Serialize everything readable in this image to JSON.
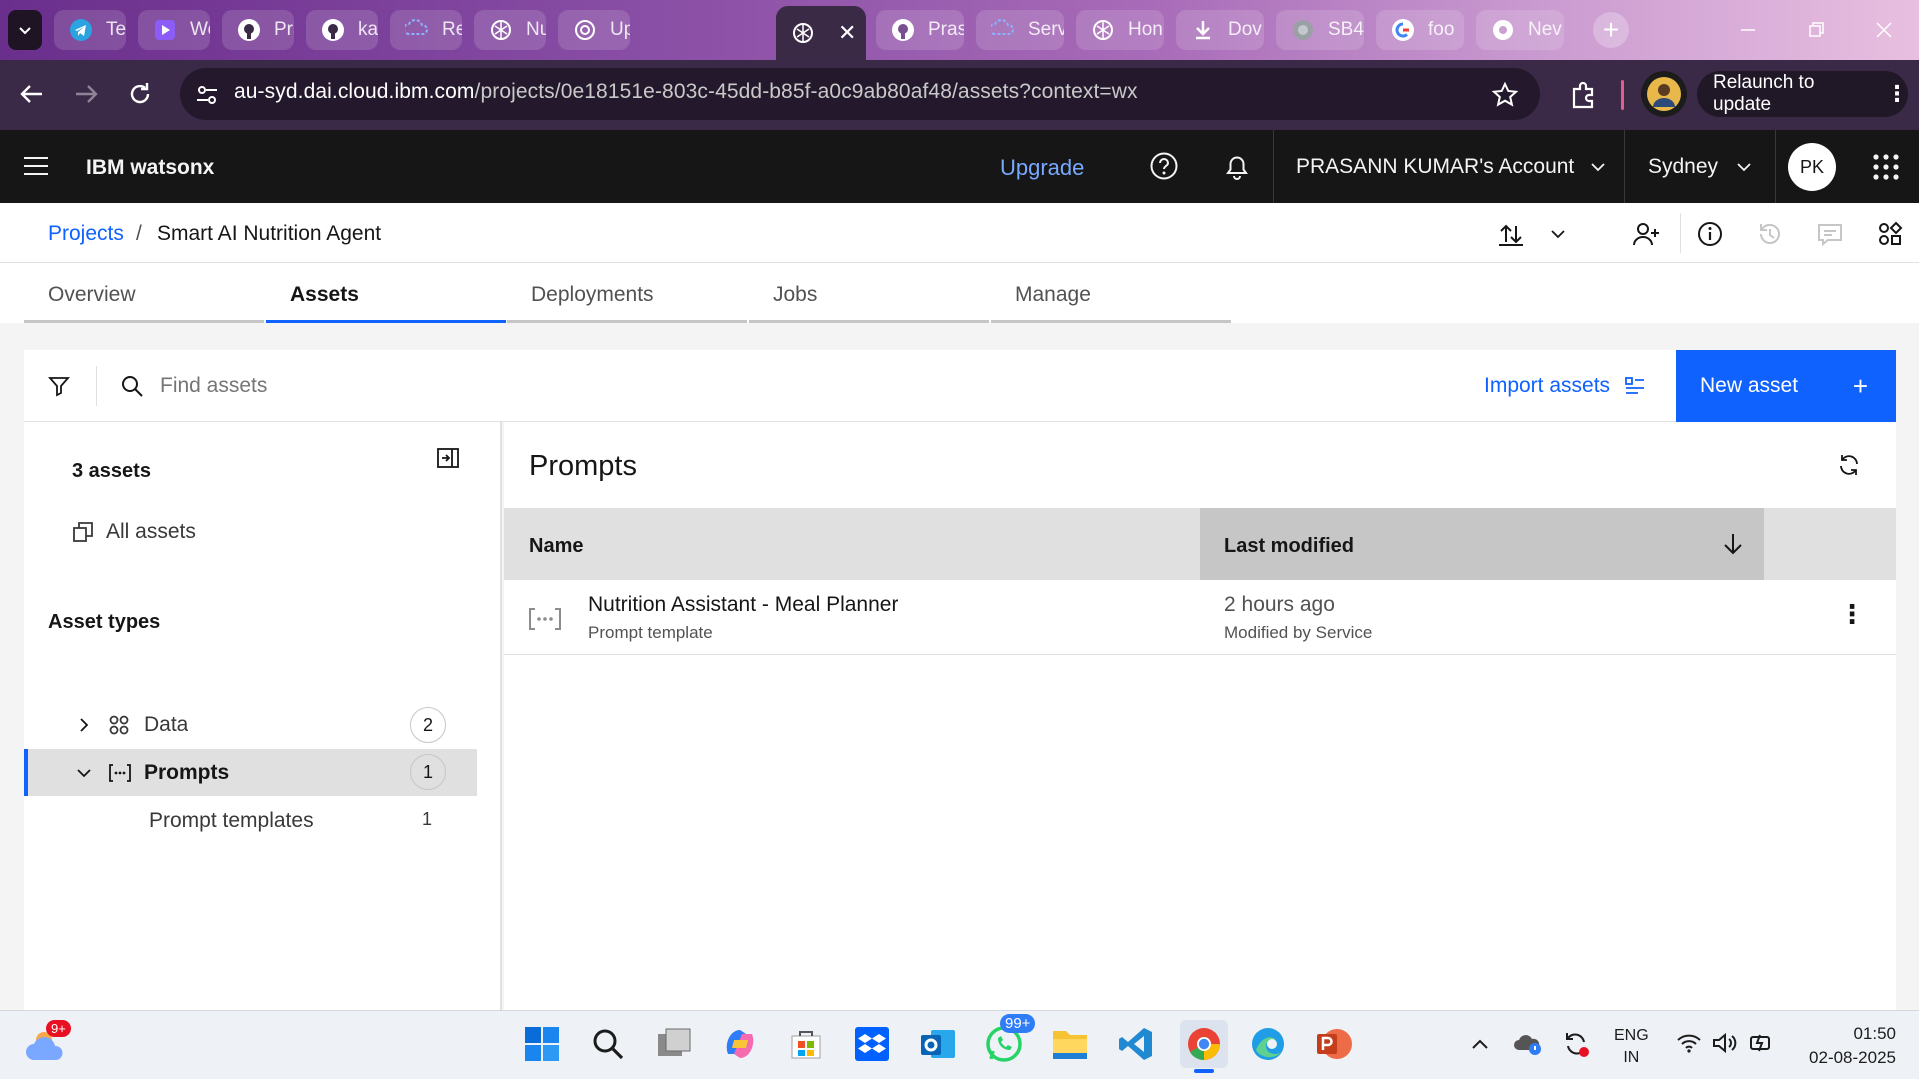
{
  "browser": {
    "tabs": [
      {
        "label": "Tele",
        "icon": "telegram-icon"
      },
      {
        "label": "Wee",
        "icon": "video-icon"
      },
      {
        "label": "Pras",
        "icon": "github-icon"
      },
      {
        "label": "kail",
        "icon": "github-icon"
      },
      {
        "label": "Reso",
        "icon": "ibm-cloud-icon"
      },
      {
        "label": "Nut",
        "icon": "watsonx-icon"
      },
      {
        "label": "Upl",
        "icon": "openai-icon"
      },
      {
        "label": "",
        "icon": "watsonx-icon",
        "active": true
      },
      {
        "label": "Pras",
        "icon": "github-icon"
      },
      {
        "label": "Serv",
        "icon": "ibm-cloud-icon"
      },
      {
        "label": "Hon",
        "icon": "watsonx-icon"
      },
      {
        "label": "Dov",
        "icon": "download-icon"
      },
      {
        "label": "SB4",
        "icon": "globe-icon"
      },
      {
        "label": "foo",
        "icon": "google-icon"
      },
      {
        "label": "Nev",
        "icon": "chrome-icon"
      }
    ],
    "url_domain": "au-syd.dai.cloud.ibm.com",
    "url_path": "/projects/0e18151e-803c-45dd-b85f-a0c9ab80af48/assets?context=wx",
    "relaunch_label": "Relaunch to update"
  },
  "header": {
    "brand": "IBM watsonx",
    "upgrade": "Upgrade",
    "account": "PRASANN KUMAR's Account",
    "region": "Sydney",
    "avatar": "PK"
  },
  "breadcrumb": {
    "projects": "Projects",
    "separator": "/",
    "project": "Smart AI Nutrition Agent"
  },
  "tabs": [
    "Overview",
    "Assets",
    "Deployments",
    "Jobs",
    "Manage"
  ],
  "toolbar": {
    "search_placeholder": "Find assets",
    "import_label": "Import assets",
    "new_label": "New asset",
    "new_plus": "+"
  },
  "sidebar": {
    "count": "3 assets",
    "all": "All assets",
    "types_heading": "Asset types",
    "items": [
      {
        "label": "Data",
        "count": "2"
      },
      {
        "label": "Prompts",
        "count": "1"
      }
    ],
    "sub": {
      "label": "Prompt templates",
      "count": "1"
    }
  },
  "main": {
    "title": "Prompts",
    "col_name": "Name",
    "col_modified": "Last modified",
    "rows": [
      {
        "name": "Nutrition Assistant - Meal Planner",
        "type": "Prompt template",
        "when": "2 hours ago",
        "by": "Modified by Service"
      }
    ]
  },
  "taskbar": {
    "weather_badge": "9+",
    "whatsapp_badge": "99+",
    "lang1": "ENG",
    "lang2": "IN",
    "time": "01:50",
    "date": "02-08-2025"
  },
  "colors": {
    "accent": "#0f62fe",
    "header_bg": "#161616",
    "selected_row": "#e0e0e0"
  }
}
